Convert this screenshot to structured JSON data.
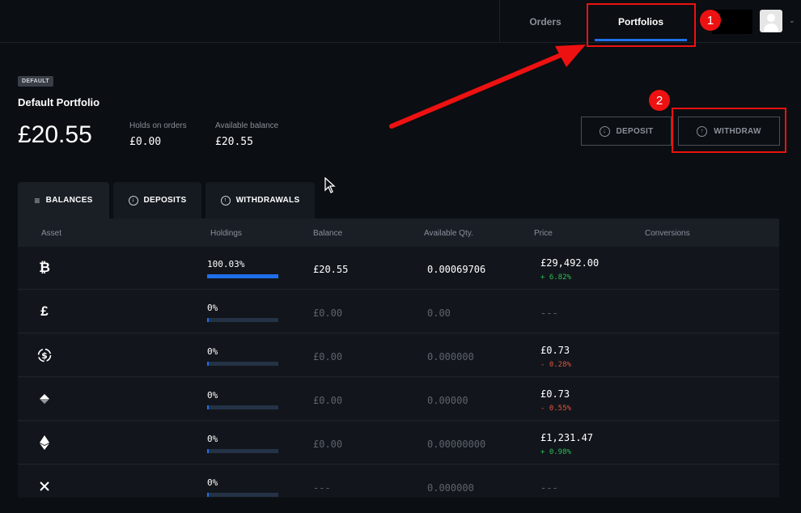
{
  "nav": {
    "orders": "Orders",
    "portfolios": "Portfolios"
  },
  "portfolio": {
    "badge": "DEFAULT",
    "title": "Default Portfolio",
    "total": "£20.55",
    "holds_label": "Holds on orders",
    "holds_value": "£0.00",
    "available_label": "Available balance",
    "available_value": "£20.55"
  },
  "actions": {
    "deposit": "DEPOSIT",
    "withdraw": "WITHDRAW"
  },
  "annotations": [
    "1",
    "2"
  ],
  "tabs": {
    "balances": "BALANCES",
    "deposits": "DEPOSITS",
    "withdrawals": "WITHDRAWALS"
  },
  "table": {
    "headers": [
      "Asset",
      "Holdings",
      "Balance",
      "Available Qty.",
      "Price",
      "Conversions"
    ],
    "rows": [
      {
        "icon": "bitcoin-icon",
        "holdings": "100.03%",
        "fill": 1.0,
        "balance": "£20.55",
        "qty": "0.00069706",
        "price": "£29,492.00",
        "change": "+ 6.82%",
        "dir": "up"
      },
      {
        "icon": "pound-icon",
        "holdings": "0%",
        "fill": 0,
        "balance": "£0.00",
        "qty": "0.00",
        "price": "---",
        "change": "",
        "dir": ""
      },
      {
        "icon": "usdc-icon",
        "holdings": "0%",
        "fill": 0,
        "balance": "£0.00",
        "qty": "0.000000",
        "price": "£0.73",
        "change": "- 0.28%",
        "dir": "down"
      },
      {
        "icon": "diamond-icon",
        "holdings": "0%",
        "fill": 0,
        "balance": "£0.00",
        "qty": "0.00000",
        "price": "£0.73",
        "change": "- 0.55%",
        "dir": "down"
      },
      {
        "icon": "ethereum-icon",
        "holdings": "0%",
        "fill": 0,
        "balance": "£0.00",
        "qty": "0.00000000",
        "price": "£1,231.47",
        "change": "+ 0.98%",
        "dir": "up"
      },
      {
        "icon": "x-icon",
        "holdings": "0%",
        "fill": 0,
        "balance": "---",
        "qty": "0.000000",
        "price": "---",
        "change": "",
        "dir": ""
      }
    ]
  },
  "colors": {
    "accent": "#1f6feb",
    "annotation": "#ee1111",
    "positive": "#2ebd57",
    "negative": "#e5533d"
  }
}
